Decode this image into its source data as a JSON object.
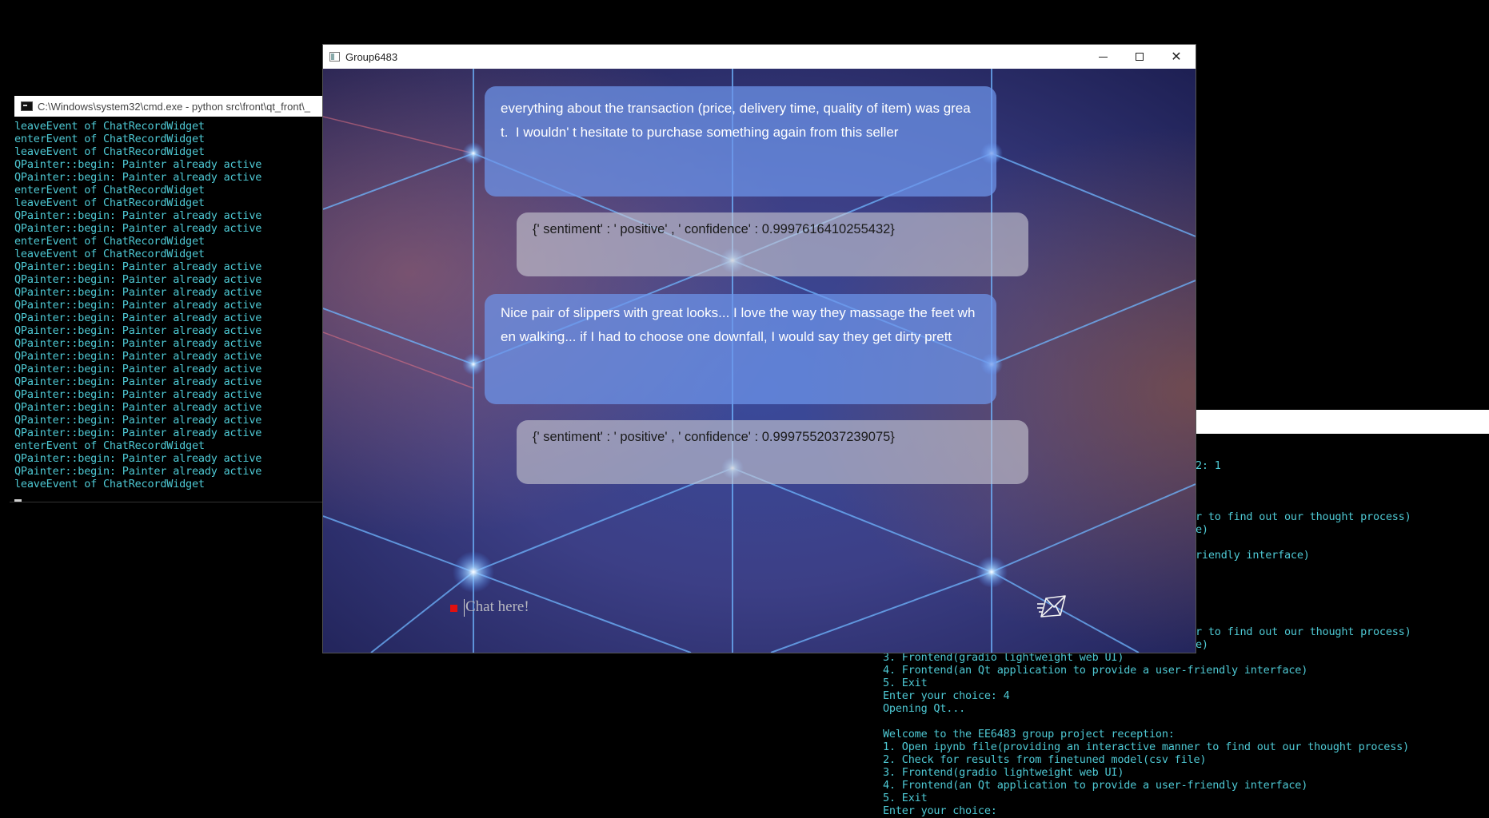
{
  "cmd_window": {
    "title": "C:\\Windows\\system32\\cmd.exe - python  src\\front\\qt_front\\_",
    "lines": [
      "leaveEvent of ChatRecordWidget",
      "enterEvent of ChatRecordWidget",
      "leaveEvent of ChatRecordWidget",
      "QPainter::begin: Painter already active",
      "QPainter::begin: Painter already active",
      "enterEvent of ChatRecordWidget",
      "leaveEvent of ChatRecordWidget",
      "QPainter::begin: Painter already active",
      "QPainter::begin: Painter already active",
      "enterEvent of ChatRecordWidget",
      "leaveEvent of ChatRecordWidget",
      "QPainter::begin: Painter already active",
      "QPainter::begin: Painter already active",
      "QPainter::begin: Painter already active",
      "QPainter::begin: Painter already active",
      "QPainter::begin: Painter already active",
      "QPainter::begin: Painter already active",
      "QPainter::begin: Painter already active",
      "QPainter::begin: Painter already active",
      "QPainter::begin: Painter already active",
      "QPainter::begin: Painter already active",
      "QPainter::begin: Painter already active",
      "QPainter::begin: Painter already active",
      "QPainter::begin: Painter already active",
      "QPainter::begin: Painter already active",
      "enterEvent of ChatRecordWidget",
      "QPainter::begin: Painter already active",
      "QPainter::begin: Painter already active",
      "leaveEvent of ChatRecordWidget"
    ]
  },
  "console2": {
    "fragments": {
      "f1": "2: 1",
      "f2": "r to find out our thought process)",
      "f3": "e)",
      "f4": "riendly interface)",
      "f5": "r to find out our thought process)",
      "f6": "e)"
    },
    "lines": [
      "3. Frontend(gradio lightweight web UI)",
      "4. Frontend(an Qt application to provide a user-friendly interface)",
      "5. Exit",
      "Enter your choice: 4",
      "Opening Qt...",
      "",
      "Welcome to the EE6483 group project reception:",
      "1. Open ipynb file(providing an interactive manner to find out our thought process)",
      "2. Check for results from finetuned model(csv file)",
      "3. Frontend(gradio lightweight web UI)",
      "4. Frontend(an Qt application to provide a user-friendly interface)",
      "5. Exit",
      "Enter your choice:"
    ]
  },
  "qt_window": {
    "title": "Group6483",
    "icons": {
      "minimize": "minimize-icon",
      "maximize": "maximize-icon",
      "close": "close-icon",
      "send": "send-mail-icon"
    },
    "close_glyph": "✕",
    "messages": [
      {
        "role": "user",
        "line1": "everything about the transaction (price, delivery time, quality of item) was grea",
        "line2": "t.  I wouldn' t hesitate to purchase something again from this seller"
      },
      {
        "role": "bot",
        "text": "{' sentiment' : ' positive' , ' confidence' : 0.9997616410255432}"
      },
      {
        "role": "user",
        "line1": "Nice pair of slippers with great looks... I love the way they massage the feet wh",
        "line2": "en walking... if I had to choose one downfall, I would say they get dirty prett"
      },
      {
        "role": "bot",
        "text": "{' sentiment' : ' positive' , ' confidence' : 0.9997552037239075}"
      }
    ],
    "chat_input": {
      "placeholder": "Chat here!",
      "value": ""
    },
    "colors": {
      "user_bubble": "#6e96eb",
      "bot_bubble": "#c8c8d2",
      "record_dot": "#e01010"
    }
  }
}
